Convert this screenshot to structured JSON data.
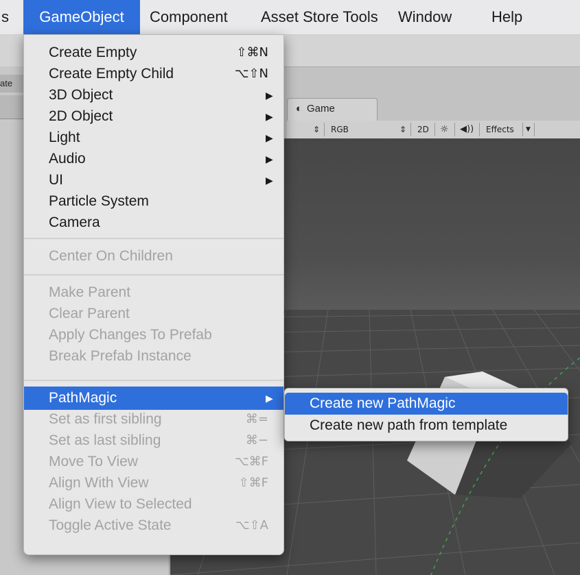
{
  "menubar": {
    "items": [
      {
        "label": "s",
        "active": false
      },
      {
        "label": "GameObject",
        "active": true
      },
      {
        "label": "Component",
        "active": false
      },
      {
        "label": "Asset Store Tools",
        "active": false
      },
      {
        "label": "Window",
        "active": false
      },
      {
        "label": "Help",
        "active": false
      }
    ]
  },
  "left_panel": {
    "tab_label": "ate"
  },
  "game_view": {
    "tab_label": "Game",
    "tab_icon": "game-controller-icon",
    "toolbar": {
      "color_mode": "RGB",
      "mode_2d": "2D",
      "effects": "Effects"
    }
  },
  "gameobject_menu": {
    "items": [
      {
        "label": "Create Empty",
        "shortcut": "⇧⌘N",
        "enabled": true,
        "submenu": false
      },
      {
        "label": "Create Empty Child",
        "shortcut": "⌥⇧N",
        "enabled": true,
        "submenu": false
      },
      {
        "label": "3D Object",
        "shortcut": "",
        "enabled": true,
        "submenu": true
      },
      {
        "label": "2D Object",
        "shortcut": "",
        "enabled": true,
        "submenu": true
      },
      {
        "label": "Light",
        "shortcut": "",
        "enabled": true,
        "submenu": true
      },
      {
        "label": "Audio",
        "shortcut": "",
        "enabled": true,
        "submenu": true
      },
      {
        "label": "UI",
        "shortcut": "",
        "enabled": true,
        "submenu": true
      },
      {
        "label": "Particle System",
        "shortcut": "",
        "enabled": true,
        "submenu": false
      },
      {
        "label": "Camera",
        "shortcut": "",
        "enabled": true,
        "submenu": false
      },
      {
        "label": "Center On Children",
        "shortcut": "",
        "enabled": false,
        "submenu": false
      },
      {
        "label": "Make Parent",
        "shortcut": "",
        "enabled": false,
        "submenu": false
      },
      {
        "label": "Clear Parent",
        "shortcut": "",
        "enabled": false,
        "submenu": false
      },
      {
        "label": "Apply Changes To Prefab",
        "shortcut": "",
        "enabled": false,
        "submenu": false
      },
      {
        "label": "Break Prefab Instance",
        "shortcut": "",
        "enabled": false,
        "submenu": false
      },
      {
        "label": "PathMagic",
        "shortcut": "",
        "enabled": true,
        "submenu": true,
        "highlighted": true
      },
      {
        "label": "Set as first sibling",
        "shortcut": "⌘=",
        "enabled": false,
        "submenu": false
      },
      {
        "label": "Set as last sibling",
        "shortcut": "⌘−",
        "enabled": false,
        "submenu": false
      },
      {
        "label": "Move To View",
        "shortcut": "⌥⌘F",
        "enabled": false,
        "submenu": false
      },
      {
        "label": "Align With View",
        "shortcut": "⇧⌘F",
        "enabled": false,
        "submenu": false
      },
      {
        "label": "Align View to Selected",
        "shortcut": "",
        "enabled": false,
        "submenu": false
      },
      {
        "label": "Toggle Active State",
        "shortcut": "⌥⇧A",
        "enabled": false,
        "submenu": false
      }
    ]
  },
  "pathmagic_submenu": {
    "items": [
      {
        "label": "Create new PathMagic",
        "highlighted": true
      },
      {
        "label": "Create new path from template",
        "highlighted": false
      }
    ]
  },
  "colors": {
    "menu_bg": "#e7e7e7",
    "highlight": "#2f6fdc",
    "disabled_text": "#a3a3a3",
    "viewport": "#474747"
  }
}
